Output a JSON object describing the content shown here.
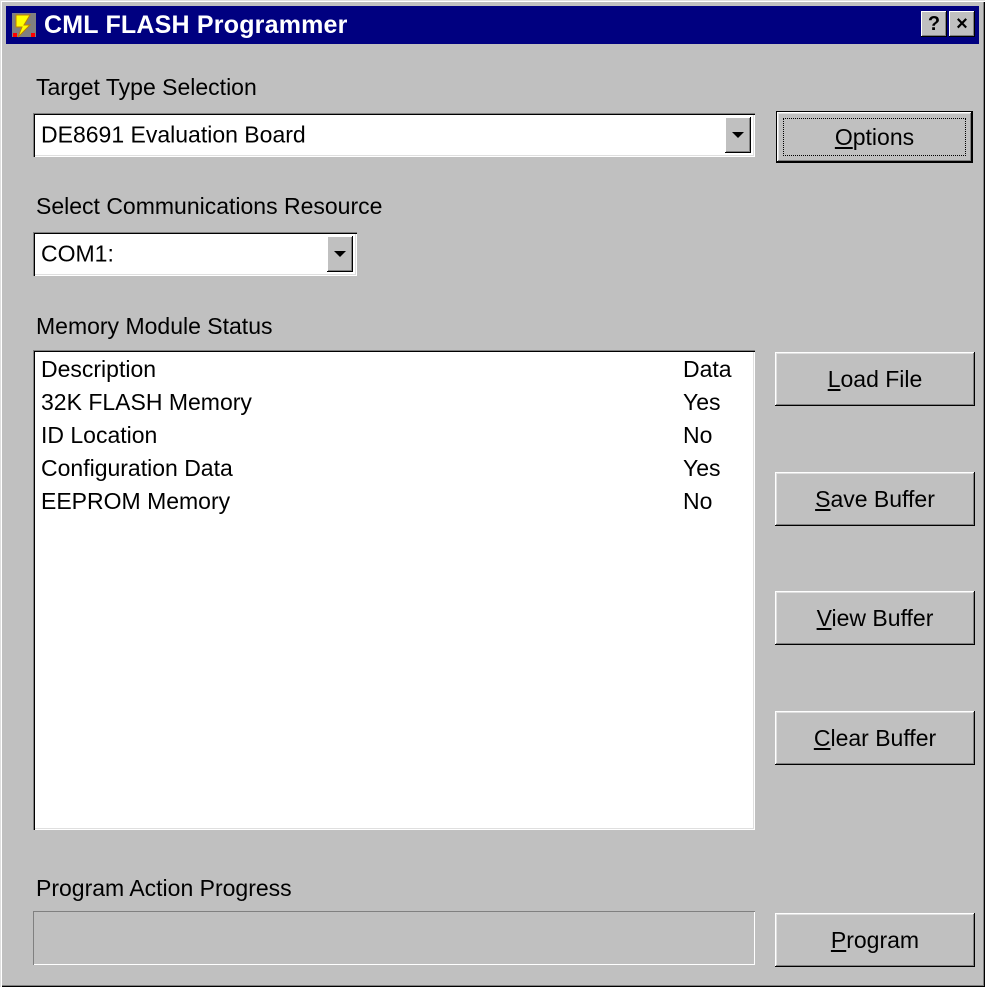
{
  "window": {
    "title": "CML FLASH Programmer",
    "help_button": "?",
    "close_button": "×"
  },
  "target": {
    "label": "Target Type Selection",
    "selected": "DE8691 Evaluation Board"
  },
  "comms": {
    "label": "Select Communications Resource",
    "selected": "COM1:"
  },
  "memory": {
    "label": "Memory Module Status",
    "columns": [
      "Description",
      "Data"
    ],
    "rows": [
      [
        "32K FLASH Memory",
        "Yes"
      ],
      [
        "ID Location",
        "No"
      ],
      [
        "Configuration Data",
        "Yes"
      ],
      [
        "EEPROM Memory",
        "No"
      ]
    ]
  },
  "buttons": {
    "options": {
      "accel": "O",
      "rest": "ptions"
    },
    "load_file": {
      "accel": "L",
      "rest": "oad File"
    },
    "save_buffer": {
      "accel": "S",
      "rest": "ave Buffer"
    },
    "view_buffer": {
      "accel": "V",
      "rest": "iew Buffer"
    },
    "clear_buffer": {
      "accel": "C",
      "rest": "lear Buffer"
    },
    "program": {
      "accel": "P",
      "rest": "rogram"
    }
  },
  "progress": {
    "label": "Program Action Progress",
    "value": 0
  },
  "icons": {
    "app": "flash-programmer-icon",
    "help": "help-icon",
    "close": "close-icon",
    "dropdown": "chevron-down-icon"
  }
}
